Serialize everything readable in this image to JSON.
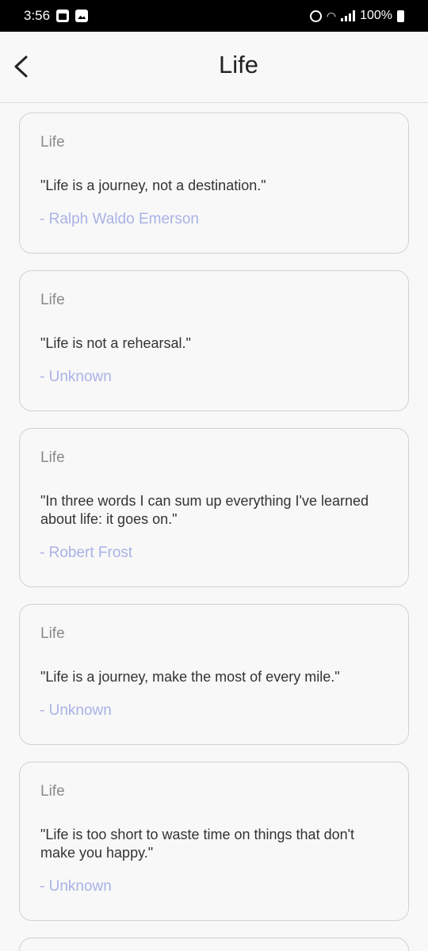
{
  "status_bar": {
    "time": "3:56",
    "battery": "100%"
  },
  "app_bar": {
    "title": "Life"
  },
  "quotes": [
    {
      "category": "Life",
      "text": "\"Life is a journey, not a destination.\"",
      "author": "- Ralph Waldo Emerson"
    },
    {
      "category": "Life",
      "text": "\"Life is not a rehearsal.\"",
      "author": "- Unknown"
    },
    {
      "category": "Life",
      "text": "\"In three words I can sum up everything I've learned about life: it goes on.\"",
      "author": "- Robert Frost"
    },
    {
      "category": "Life",
      "text": "\"Life is a journey, make the most of every mile.\"",
      "author": "- Unknown"
    },
    {
      "category": "Life",
      "text": "\"Life is too short to waste time on things that don't make you happy.\"",
      "author": "- Unknown"
    }
  ],
  "colors": {
    "author": "#a9b2e6",
    "category": "#8a8a8a",
    "background": "#f8f8f8"
  }
}
